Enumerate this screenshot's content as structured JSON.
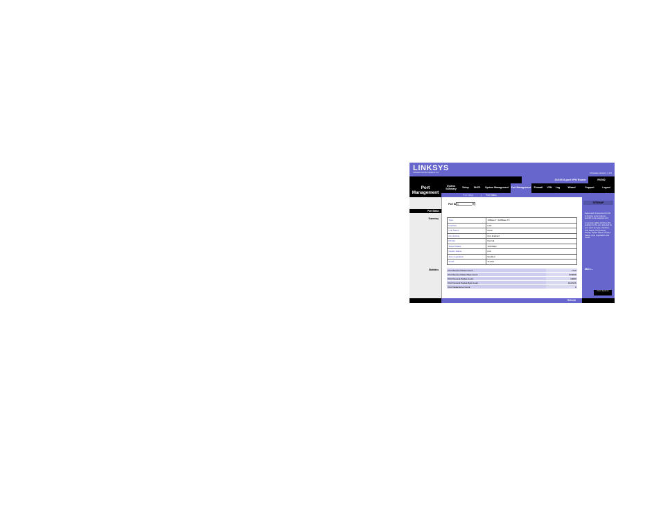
{
  "header": {
    "logo": "LINKSYS",
    "logo_tagline": "A Division of Cisco Systems, Inc.",
    "firmware": "Firmware Version: 1.0.0",
    "model": "10/100 8-port VPN Router",
    "model_name": "RV082"
  },
  "page_title": "Port Management",
  "nav": {
    "tabs": [
      {
        "label": "System Summary"
      },
      {
        "label": "Setup"
      },
      {
        "label": "DHCP"
      },
      {
        "label": "System Management"
      },
      {
        "label": "Port Management"
      },
      {
        "label": "Firewall"
      },
      {
        "label": "VPN"
      },
      {
        "label": "Log"
      },
      {
        "label": "Wizard"
      },
      {
        "label": "Support"
      },
      {
        "label": "Logout"
      }
    ],
    "subtabs": [
      {
        "label": "Port Setup"
      },
      {
        "label": "Port Status"
      }
    ]
  },
  "left": {
    "section": "Port Status",
    "summary_label": "Summary",
    "statistics_label": "Statistics"
  },
  "port_select": {
    "label": "Port ID :",
    "value": "1"
  },
  "summary": [
    {
      "key": "Type",
      "value": "10Base-T / 100Base-TX"
    },
    {
      "key": "Interface",
      "value": "LAN"
    },
    {
      "key": "Link Status",
      "value": "Down"
    },
    {
      "key": "Port Activity",
      "value": "Port Enabled"
    },
    {
      "key": "Priority",
      "value": "Normal"
    },
    {
      "key": "Speed Status",
      "value": "100 Mbps"
    },
    {
      "key": "Duplex Status",
      "value": "Full"
    },
    {
      "key": "Auto negotiation",
      "value": "Enabled"
    },
    {
      "key": "VLAN",
      "value": "VLAN1"
    }
  ],
  "statistics": [
    {
      "key": "Port Receive Packet Count",
      "value": "7740"
    },
    {
      "key": "Port Receive Packet Byte Count",
      "value": "824538"
    },
    {
      "key": "Port Transmit Packet Count",
      "value": "10689"
    },
    {
      "key": "Port Transmit Packet Byte Count",
      "value": "1947026"
    },
    {
      "key": "Port Packet Error Count",
      "value": "0"
    }
  ],
  "refresh_label": "Refresh",
  "sidebar": {
    "title": "SITEMAP",
    "text1": "Select and choose the Port ID to browse some features specific to the selected port.",
    "text2": "A summary table will show the settings for the port selected for you, such as Type, Interface, Link Status, Port Activity, Priority, Speed Status, Duplex Status, Auto negotiation and VLAN.",
    "more": "More...",
    "brand": "Cisco Systems"
  }
}
